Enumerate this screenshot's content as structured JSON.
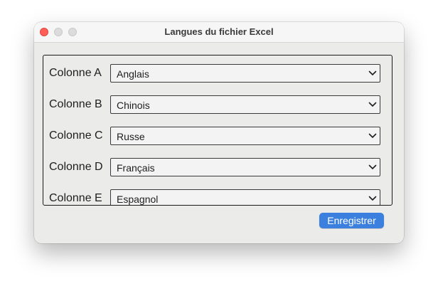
{
  "window": {
    "title": "Langues du fichier Excel"
  },
  "columns": [
    {
      "label": "Colonne A",
      "value": "Anglais"
    },
    {
      "label": "Colonne B",
      "value": "Chinois"
    },
    {
      "label": "Colonne C",
      "value": "Russe"
    },
    {
      "label": "Colonne D",
      "value": "Français"
    },
    {
      "label": "Colonne E",
      "value": "Espagnol"
    }
  ],
  "footer": {
    "save_label": "Enregistrer"
  },
  "colors": {
    "accent": "#3b80de",
    "close": "#ff5f57"
  },
  "icons": {
    "dropdown": "chevron-down-icon"
  }
}
